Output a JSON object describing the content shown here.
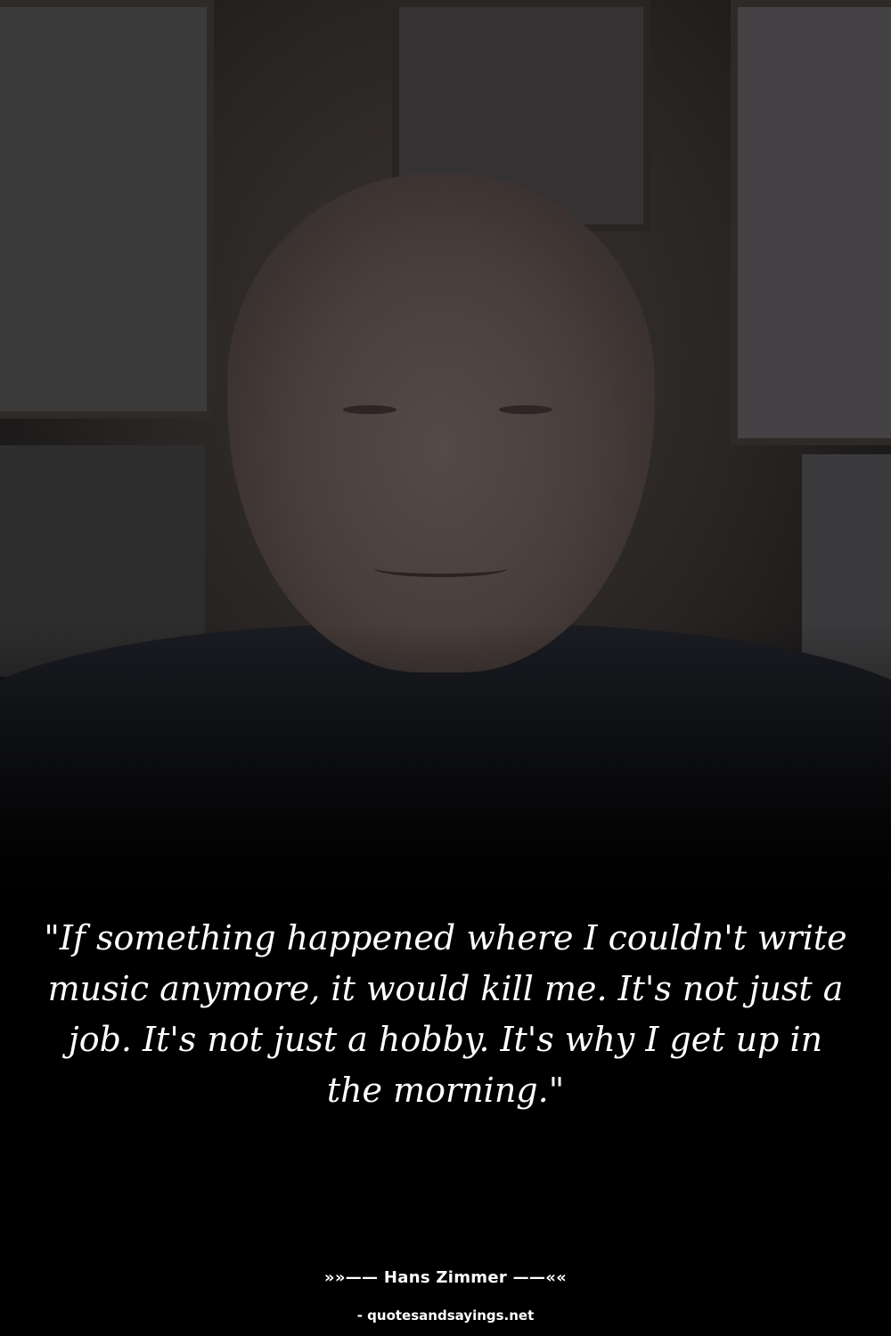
{
  "quote": {
    "text": "\"If something happened where I couldn't write music anymore, it would kill me. It's not just a job. It's not just a hobby. It's why I get up in the morning.\""
  },
  "attribution": {
    "author_line": "»»—— Hans Zimmer ——««"
  },
  "footer": {
    "source": "- quotesandsayings.net"
  },
  "colors": {
    "background": "#000000",
    "text": "#ffffff"
  }
}
